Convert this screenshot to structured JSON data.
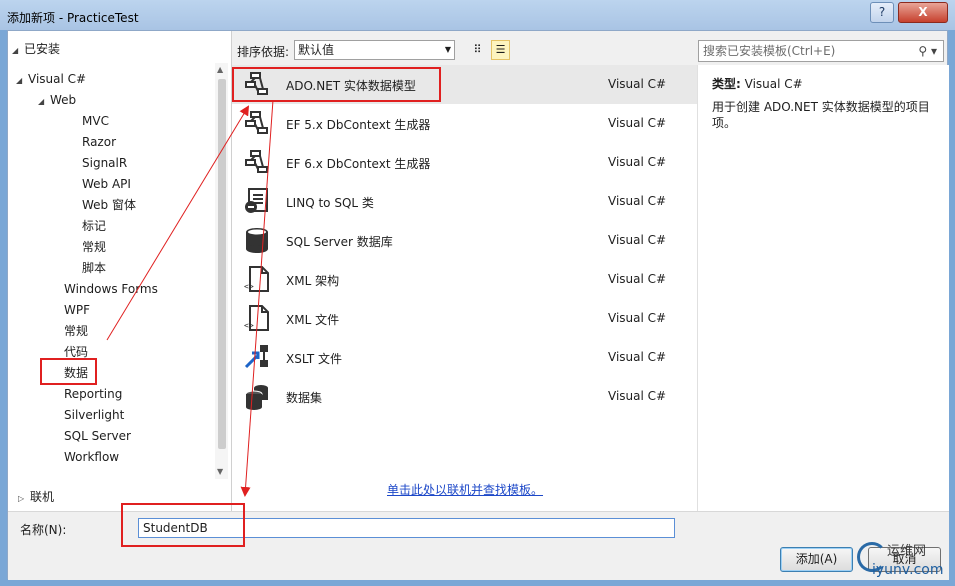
{
  "window": {
    "title": "添加新项 - PracticeTest",
    "help_label": "?",
    "close_label": "X"
  },
  "left": {
    "installed_label": "已安装",
    "tree": [
      {
        "label": "Visual C#",
        "expander": "◢"
      },
      {
        "label": "Web",
        "expander": "◢"
      },
      {
        "label": "MVC",
        "expander": ""
      },
      {
        "label": "Razor",
        "expander": ""
      },
      {
        "label": "SignalR",
        "expander": ""
      },
      {
        "label": "Web API",
        "expander": ""
      },
      {
        "label": "Web 窗体",
        "expander": ""
      },
      {
        "label": "标记",
        "expander": ""
      },
      {
        "label": "常规",
        "expander": ""
      },
      {
        "label": "脚本",
        "expander": ""
      },
      {
        "label": "Windows Forms",
        "expander": ""
      },
      {
        "label": "WPF",
        "expander": ""
      },
      {
        "label": "常规",
        "expander": ""
      },
      {
        "label": "代码",
        "expander": ""
      },
      {
        "label": "数据",
        "expander": ""
      },
      {
        "label": "Reporting",
        "expander": ""
      },
      {
        "label": "Silverlight",
        "expander": ""
      },
      {
        "label": "SQL Server",
        "expander": ""
      },
      {
        "label": "Workflow",
        "expander": ""
      }
    ],
    "online_label": "联机"
  },
  "toolbar": {
    "sort_label": "排序依据:",
    "sort_value": "默认值",
    "search_placeholder": "搜索已安装模板(Ctrl+E)"
  },
  "templates": [
    {
      "name": "ADO.NET 实体数据模型",
      "lang": "Visual C#",
      "icon": "entity-model-icon"
    },
    {
      "name": "EF 5.x DbContext 生成器",
      "lang": "Visual C#",
      "icon": "entity-model-icon"
    },
    {
      "name": "EF 6.x DbContext 生成器",
      "lang": "Visual C#",
      "icon": "entity-model-icon"
    },
    {
      "name": "LINQ to SQL 类",
      "lang": "Visual C#",
      "icon": "linq-to-sql-icon"
    },
    {
      "name": "SQL Server 数据库",
      "lang": "Visual C#",
      "icon": "database-icon"
    },
    {
      "name": "XML 架构",
      "lang": "Visual C#",
      "icon": "xml-file-icon"
    },
    {
      "name": "XML 文件",
      "lang": "Visual C#",
      "icon": "xml-file-icon"
    },
    {
      "name": "XSLT 文件",
      "lang": "Visual C#",
      "icon": "xslt-icon"
    },
    {
      "name": "数据集",
      "lang": "Visual C#",
      "icon": "dataset-icon"
    }
  ],
  "online_link": "单击此处以联机并查找模板。",
  "description": {
    "type_label": "类型:",
    "type_value": "Visual C#",
    "text": "用于创建 ADO.NET 实体数据模型的项目项。"
  },
  "bottom": {
    "name_label": "名称(N):",
    "name_value": "StudentDB",
    "add_label": "添加(A)",
    "cancel_label": "取消"
  },
  "watermark": {
    "line1": "运维网",
    "line2": "iyunv.com"
  },
  "colors": {
    "annotation": "#e02020",
    "link": "#1d48c8",
    "selected_row": "#e8e8e8"
  }
}
